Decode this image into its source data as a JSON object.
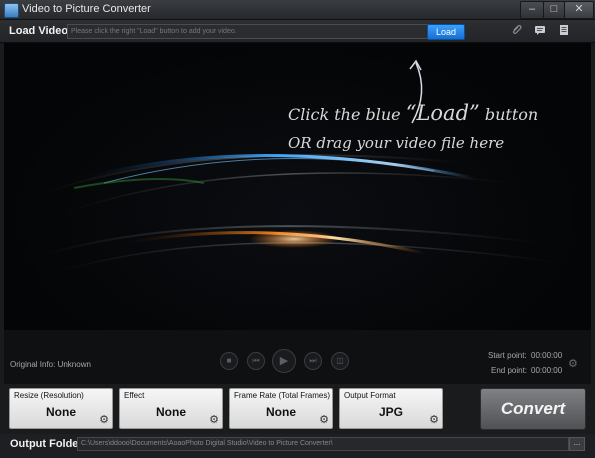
{
  "window": {
    "title": "Video to Picture Converter",
    "controls": {
      "minimize": "–",
      "maximize": "□",
      "close": "✕"
    }
  },
  "load_bar": {
    "label": "Load Video:",
    "placeholder": "Please click the right \"Load\" button to add your video.",
    "load_button": "Load",
    "icons": [
      "paperclip-icon",
      "chat-icon",
      "notes-icon"
    ]
  },
  "video_area": {
    "prompt_line1_a": "Click the blue ",
    "prompt_line1_b": "“Load”",
    "prompt_line1_c": " button",
    "prompt_line2": "OR drag your video file here"
  },
  "info": {
    "original_info": "Original Info: Unknown",
    "start_point_label": "Start point:",
    "start_point_value": "00:00:00",
    "end_point_label": "End point:",
    "end_point_value": "00:00:00"
  },
  "playback": {
    "stop": "■",
    "prev": "⏮",
    "play": "▶",
    "next": "⏭",
    "snapshot": "◫"
  },
  "settings": {
    "resize": {
      "label": "Resize (Resolution)",
      "value": "None"
    },
    "effect": {
      "label": "Effect",
      "value": "None"
    },
    "frame_rate": {
      "label": "Frame Rate (Total Frames)",
      "value": "None"
    },
    "output_format": {
      "label": "Output Format",
      "value": "JPG"
    },
    "gear_glyph": "⚙"
  },
  "convert_button": "Convert",
  "output": {
    "label": "Output Folder:",
    "path": "C:\\Users\\ddooo\\Documents\\AoaoPhoto Digital Studio\\Video to Picture Converter\\",
    "more_button": "..."
  },
  "colors": {
    "load_blue": "#1f86ea",
    "background": "#1a1b1d",
    "panel": "#e8e8e8"
  }
}
